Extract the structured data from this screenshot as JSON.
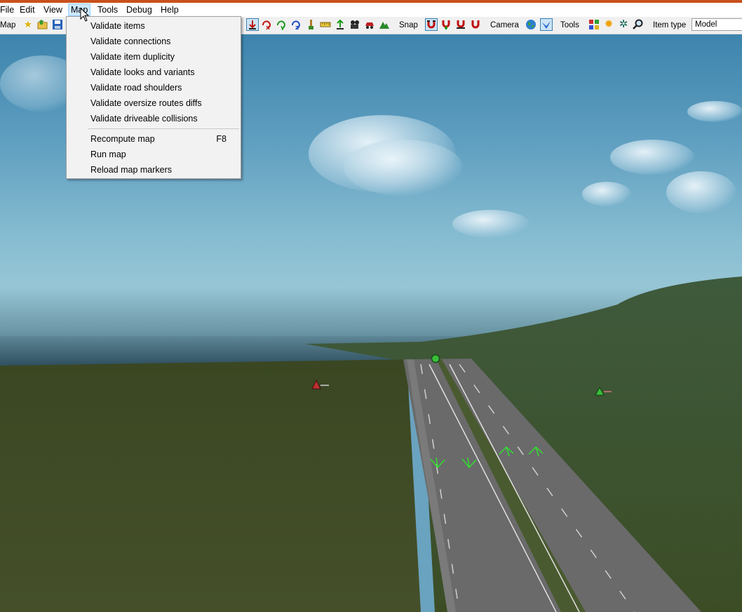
{
  "menubar": {
    "items": [
      "File",
      "Edit",
      "View",
      "Map",
      "Tools",
      "Debug",
      "Help"
    ],
    "active": "Map"
  },
  "toolbar": {
    "map_label": "Map",
    "snap_label": "Snap",
    "camera_label": "Camera",
    "tools_label": "Tools",
    "item_type_label": "Item type",
    "item_type_value": "Model",
    "icons": [
      "star-icon",
      "open-folder-icon",
      "save-icon",
      "move-down-icon",
      "rotate-x-icon",
      "rotate-y-icon",
      "rotate-z-icon",
      "brush-icon",
      "measure-icon",
      "raise-icon",
      "camera-path-icon",
      "car-icon",
      "terrain-icon",
      "snap-magnet-icon",
      "snap-magnet-add-icon",
      "snap-magnet-outline-icon",
      "snap-magnet-red-icon",
      "globe-icon",
      "bird-icon",
      "grid-icon",
      "sun-icon",
      "gear-icon",
      "zoom-icon"
    ]
  },
  "map_menu": {
    "group1": [
      "Validate items",
      "Validate connections",
      "Validate item duplicity",
      "Validate looks and variants",
      "Validate road shoulders",
      "Validate oversize routes diffs",
      "Validate driveable collisions"
    ],
    "group2": [
      {
        "label": "Recompute map",
        "shortcut": "F8"
      },
      {
        "label": "Run map",
        "shortcut": ""
      },
      {
        "label": "Reload map markers",
        "shortcut": ""
      }
    ]
  },
  "colors": {
    "accent_strip": "#c9501c",
    "menu_highlight": "#cce8ff",
    "grass": "#3f4a22",
    "road": "#6b6b6b"
  }
}
